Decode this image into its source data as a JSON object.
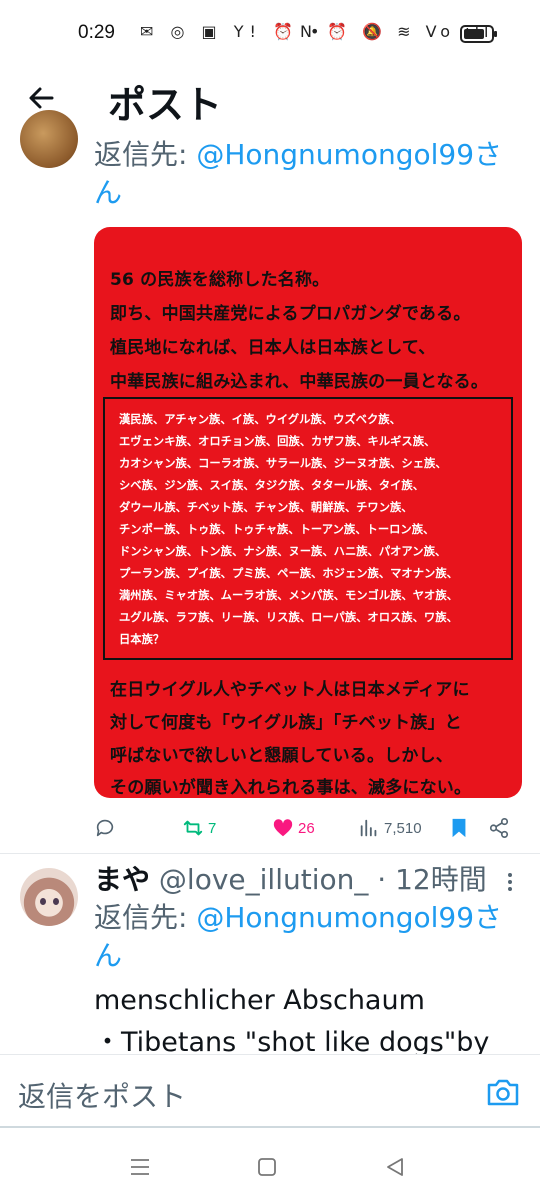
{
  "status_bar": {
    "time": "0:29",
    "left_icons": "✉ ◎ ▣ Y! ⏰ •",
    "right_icons": "N ⏰ 🔕 ≋ Vo ıll"
  },
  "header": {
    "title": "ポスト"
  },
  "thread_top": {
    "reply_prefix": "返信先: ",
    "reply_handle": "@Hongnumongol99",
    "reply_suffix": "さん"
  },
  "media": {
    "lines_top": [
      "56 の民族を総称した名称。",
      "即ち、中国共産党によるプロパガンダである。",
      "植民地になれば、日本人は日本族として、",
      "中華民族に組み込まれ、中華民族の一員となる。"
    ],
    "box_lines": [
      "漢民族、アチャン族、イ族、ウイグル族、ウズベク族、",
      "エヴェンキ族、オロチョン族、回族、カザフ族、キルギス族、",
      "カオシャン族、コーラオ族、サラール族、ジーヌオ族、シェ族、",
      "シベ族、ジン族、スイ族、タジク族、タタール族、タイ族、",
      "ダウール族、チベット族、チャン族、朝鮮族、チワン族、",
      "チンポー族、トゥ族、トゥチャ族、トーアン族、トーロン族、",
      "ドンシャン族、トン族、ナシ族、ヌー族、ハニ族、パオアン族、",
      "プーラン族、プイ族、プミ族、ペー族、ホジェン族、マオナン族、",
      "満州族、ミャオ族、ムーラオ族、メンパ族、モンゴル族、ヤオ族、",
      "ユグル族、ラフ族、リー族、リス族、ローパ族、オロス族、ワ族、",
      "日本族？"
    ],
    "lines_bottom": [
      "在日ウイグル人やチベット人は日本メディアに",
      "対して何度も「ウイグル族」「チベット族」と",
      "呼ばないで欲しいと懇願している。しかし、",
      "その願いが聞き入れられる事は、滅多にない。"
    ]
  },
  "actions": {
    "retweet_count": "7",
    "like_count": "26",
    "views_count": "7,510"
  },
  "tweet2": {
    "display_name": "まや",
    "handle": "@love_illution_",
    "separator": " · ",
    "time": "12時間",
    "reply_prefix": "返信先: ",
    "reply_handle": "@Hongnumongol99",
    "reply_suffix": "さん",
    "body_lines": [
      "menschlicher Abschaum",
      "・Tibetans \"shot like dogs\"by"
    ]
  },
  "compose": {
    "placeholder": "返信をポスト"
  },
  "colors": {
    "accent": "#1d9bf0",
    "retweet": "#00ba7c",
    "like": "#f91880",
    "muted": "#536471",
    "media_bg": "#e8141c"
  }
}
